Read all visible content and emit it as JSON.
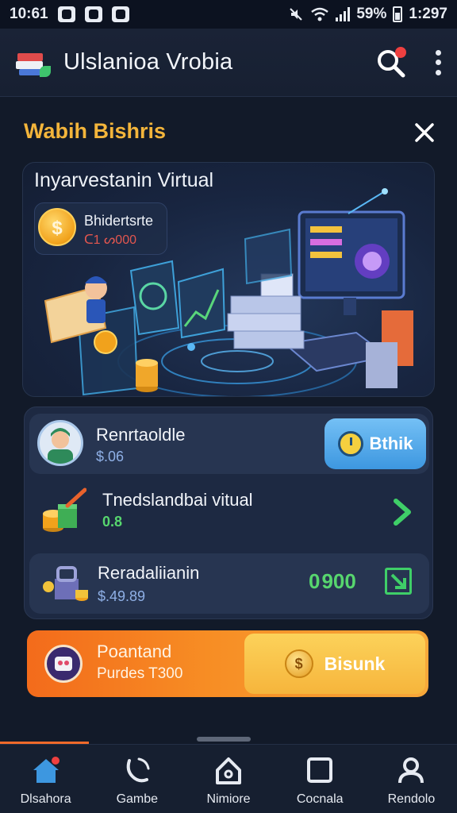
{
  "status_bar": {
    "time": "10:61",
    "battery": "59%",
    "clock": "1:297"
  },
  "app_bar": {
    "title": "Ulslanioa Vrobia",
    "icons": [
      "app-logo-icon",
      "search-icon",
      "more-vert-icon"
    ]
  },
  "section": {
    "title": "Wabih Bishris"
  },
  "hero": {
    "title": "Inyarvestanin Virtual",
    "chip_label": "Bhidertsrte",
    "chip_value": "ᑕ1 ᔕ000",
    "coin_symbol": "$"
  },
  "rows": [
    {
      "title": "Renrtaoldle",
      "sub": "$.06",
      "button": "Bthik"
    },
    {
      "title": "Tnedslandbai vitual",
      "sub": "0.8"
    },
    {
      "title": "Reradaliianin",
      "sub": "$.49.89",
      "value": "900",
      "value_prefix": "0"
    }
  ],
  "promo": {
    "title": "Poantand",
    "sub": "Purdes T300",
    "button": "Bisunk",
    "coin_symbol": "$"
  },
  "nav": [
    {
      "label": "Dlsahora",
      "icon": "home-icon"
    },
    {
      "label": "Gambe",
      "icon": "phone-icon"
    },
    {
      "label": "Nimiore",
      "icon": "house-outline-icon"
    },
    {
      "label": "Cocnala",
      "icon": "square-icon"
    },
    {
      "label": "Rendolo",
      "icon": "user-icon"
    }
  ],
  "colors": {
    "accent_gold": "#f3b53b",
    "accent_green": "#57d66e",
    "accent_blue": "#3d97e0",
    "accent_orange": "#f36b1b",
    "background": "#121a29"
  }
}
